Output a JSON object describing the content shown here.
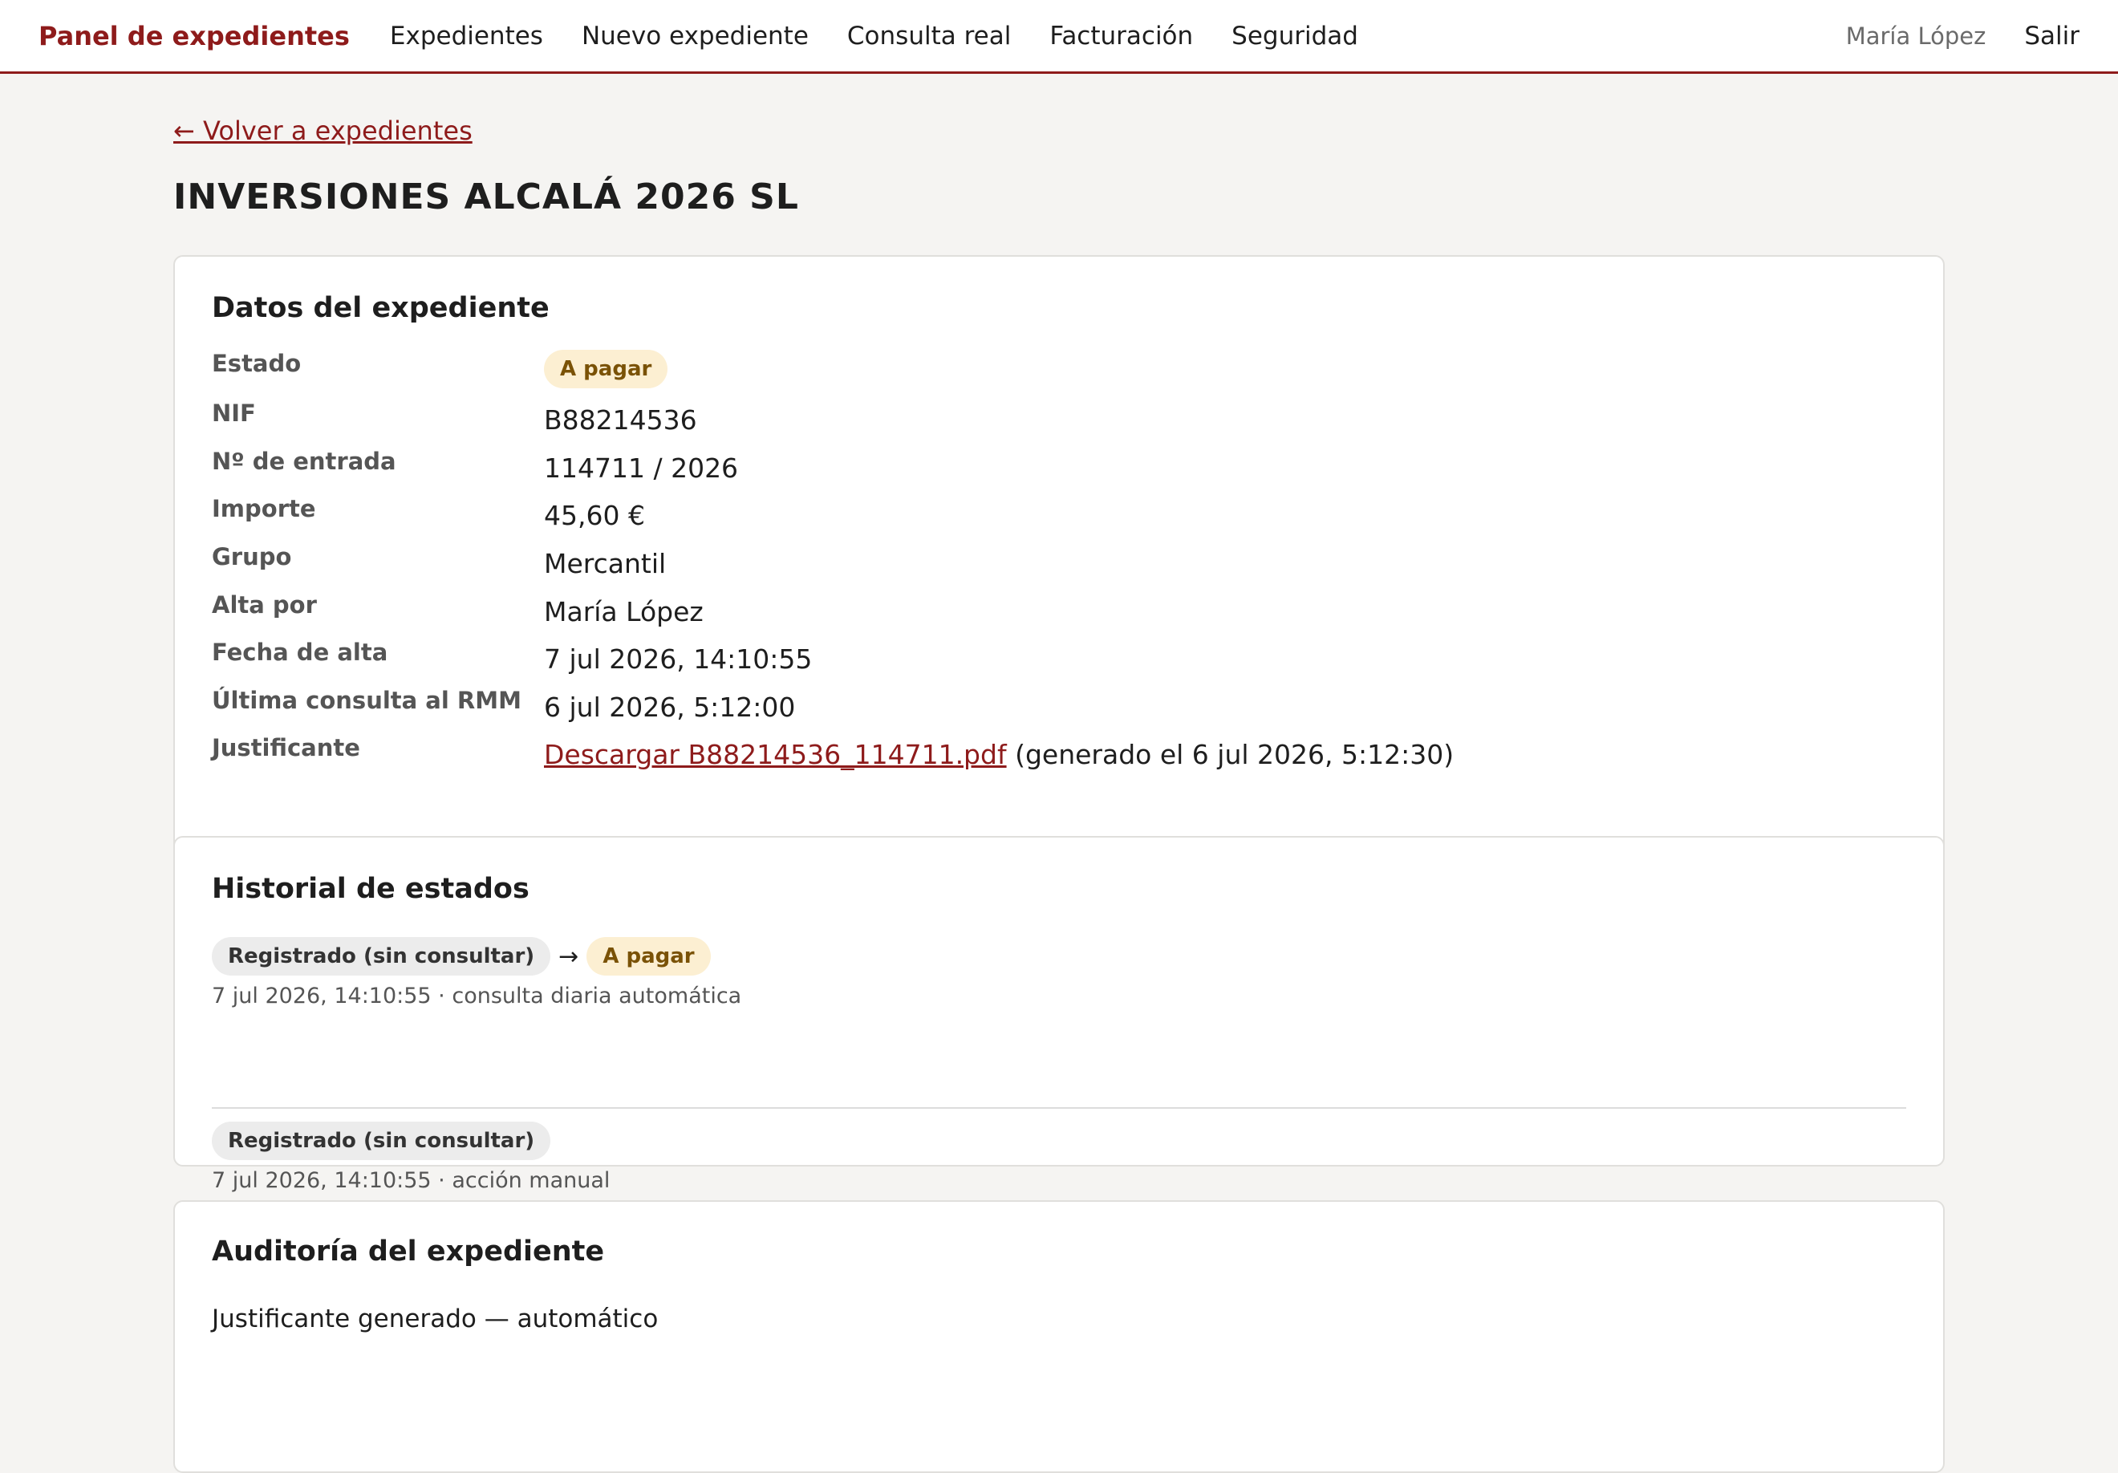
{
  "header": {
    "brand": "Panel de expedientes",
    "nav": [
      "Expedientes",
      "Nuevo expediente",
      "Consulta real",
      "Facturación",
      "Seguridad"
    ],
    "user": "María López",
    "logout": "Salir"
  },
  "back_link": "← Volver a expedientes",
  "page_title": "INVERSIONES ALCALÁ 2026 SL",
  "datos": {
    "title": "Datos del expediente",
    "estado_label": "Estado",
    "estado_value": "A pagar",
    "nif_label": "NIF",
    "nif_value": "B88214536",
    "entrada_label": "Nº de entrada",
    "entrada_value": "114711 / 2026",
    "importe_label": "Importe",
    "importe_value": "45,60 €",
    "grupo_label": "Grupo",
    "grupo_value": "Mercantil",
    "alta_por_label": "Alta por",
    "alta_por_value": "María López",
    "fecha_alta_label": "Fecha de alta",
    "fecha_alta_value": "7 jul 2026, 14:10:55",
    "ultima_label": "Última consulta al RMM",
    "ultima_value": "6 jul 2026, 5:12:00",
    "justificante_label": "Justificante",
    "justificante_link": "Descargar B88214536_114711.pdf",
    "justificante_note": " (generado el 6 jul 2026, 5:12:30)"
  },
  "historial": {
    "title": "Historial de estados",
    "arrow": "→",
    "entries": [
      {
        "from": "Registrado (sin consultar)",
        "to": "A pagar",
        "meta": "7 jul 2026, 14:10:55 · consulta diaria automática"
      },
      {
        "from": "Registrado (sin consultar)",
        "meta": "7 jul 2026, 14:10:55 · acción manual"
      }
    ]
  },
  "auditoria": {
    "title": "Auditoría del expediente",
    "items": [
      "Justificante generado — automático"
    ]
  },
  "colors": {
    "accent": "#8e1b1b",
    "badge_pay_bg": "#fcefd2",
    "badge_pay_text": "#7a5206",
    "badge_reg_bg": "#ececec"
  }
}
